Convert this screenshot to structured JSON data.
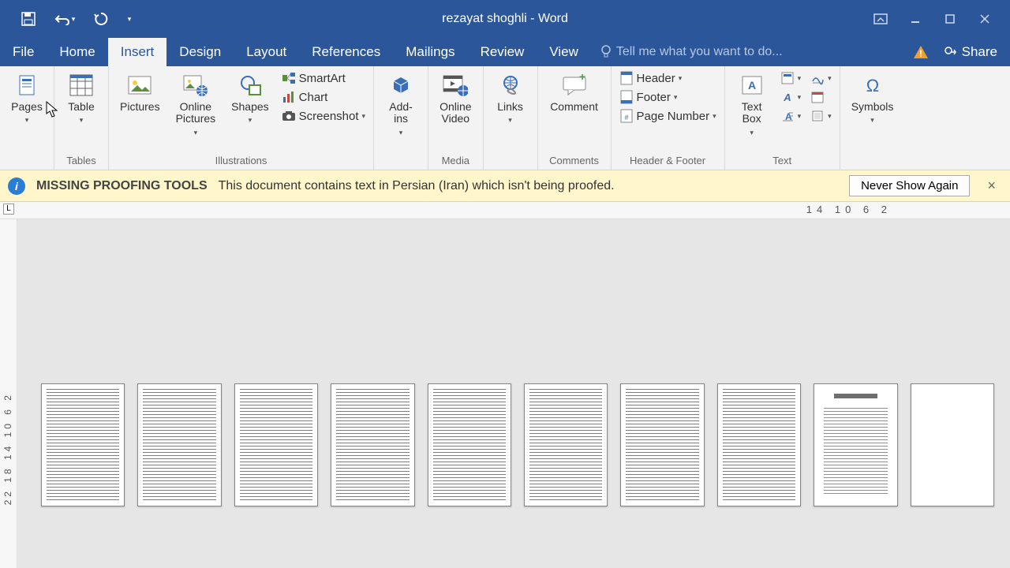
{
  "title_bar": {
    "doc_title": "rezayat shoghli - Word"
  },
  "tabs": {
    "file": "File",
    "home": "Home",
    "insert": "Insert",
    "design": "Design",
    "layout": "Layout",
    "references": "References",
    "mailings": "Mailings",
    "review": "Review",
    "view": "View",
    "tell_me": "Tell me what you want to do..."
  },
  "share": "Share",
  "ribbon": {
    "pages": {
      "label": "Pages",
      "btn": "Pages"
    },
    "tables": {
      "label": "Tables",
      "btn": "Table"
    },
    "illustrations": {
      "label": "Illustrations",
      "pictures": "Pictures",
      "online_pictures": "Online\nPictures",
      "shapes": "Shapes",
      "smartart": "SmartArt",
      "chart": "Chart",
      "screenshot": "Screenshot"
    },
    "addins": {
      "label": "",
      "btn": "Add-\nins"
    },
    "media": {
      "label": "Media",
      "btn": "Online\nVideo"
    },
    "links": {
      "btn": "Links"
    },
    "comments": {
      "label": "Comments",
      "btn": "Comment"
    },
    "header_footer": {
      "label": "Header & Footer",
      "header": "Header",
      "footer": "Footer",
      "page_number": "Page Number"
    },
    "text": {
      "label": "Text",
      "textbox": "Text\nBox"
    },
    "symbols": {
      "label": "Symbols",
      "btn": "Symbols"
    }
  },
  "notif": {
    "title": "MISSING PROOFING TOOLS",
    "msg": "This document contains text in Persian (Iran) which isn't being proofed.",
    "btn": "Never Show Again"
  },
  "ruler": {
    "corner": "L",
    "marks": "14 10  6  2",
    "vmarks": "22 18 14 10 6 2"
  }
}
